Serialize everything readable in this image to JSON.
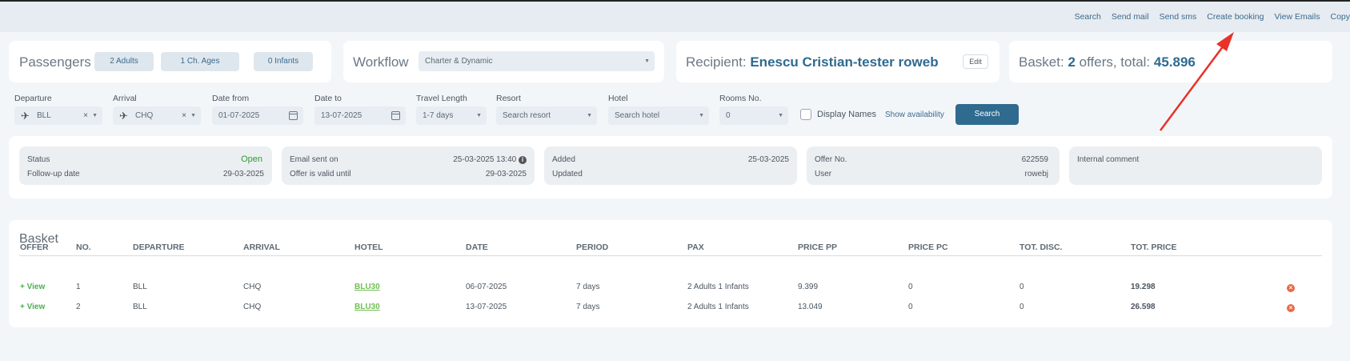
{
  "topnav": [
    "Search",
    "Send mail",
    "Send sms",
    "Create booking",
    "View Emails",
    "Copy"
  ],
  "passengers": {
    "title": "Passengers",
    "adults": "2 Adults",
    "children": "1 Ch. Ages",
    "infants": "0 Infants"
  },
  "workflow": {
    "title": "Workflow",
    "value": "Charter & Dynamic"
  },
  "recipient": {
    "label": "Recipient:",
    "name": "Enescu Cristian-tester roweb",
    "edit": "Edit"
  },
  "basket_summary": {
    "label": "Basket:",
    "count": "2",
    "mid": "offers, total:",
    "total": "45.896"
  },
  "search": {
    "departure_label": "Departure",
    "departure_value": "BLL",
    "arrival_label": "Arrival",
    "arrival_value": "CHQ",
    "date_from_label": "Date from",
    "date_from_value": "01-07-2025",
    "date_to_label": "Date to",
    "date_to_value": "13-07-2025",
    "travel_label": "Travel Length",
    "travel_value": "1-7 days",
    "resort_label": "Resort",
    "resort_placeholder": "Search resort",
    "hotel_label": "Hotel",
    "hotel_placeholder": "Search hotel",
    "rooms_label": "Rooms No.",
    "rooms_value": "0",
    "display_names": "Display Names",
    "show_availability": "Show availability",
    "search_button": "Search"
  },
  "status": {
    "status_label": "Status",
    "status_value": "Open",
    "followup_label": "Follow-up date",
    "followup_value": "29-03-2025"
  },
  "email": {
    "sent_label": "Email sent on",
    "sent_value": "25-03-2025 13:40",
    "valid_label": "Offer is valid until",
    "valid_value": "29-03-2025"
  },
  "added": {
    "added_label": "Added",
    "added_value": "25-03-2025",
    "updated_label": "Updated"
  },
  "offer": {
    "no_label": "Offer No.",
    "no_value": "622559",
    "user_label": "User",
    "user_value": "rowebj"
  },
  "comment": {
    "label": "Internal comment"
  },
  "colors": {
    "accent": "#2f6a8f",
    "open": "#2e9d2e",
    "link_green": "#4caf50",
    "delete": "#e86a4a"
  },
  "basket": {
    "title": "Basket",
    "columns": [
      "OFFER",
      "NO.",
      "DEPARTURE",
      "ARRIVAL",
      "HOTEL",
      "DATE",
      "PERIOD",
      "PAX",
      "PRICE PP",
      "PRICE PC",
      "TOT. DISC.",
      "TOT. PRICE"
    ],
    "rows": [
      {
        "offer": "+ View",
        "no": "1",
        "departure": "BLL",
        "arrival": "CHQ",
        "hotel": "BLU30",
        "date": "06-07-2025",
        "period": "7 days",
        "pax": "2 Adults 1 Infants",
        "price_pp": "9.399",
        "price_pc": "0",
        "disc": "0",
        "total": "19.298"
      },
      {
        "offer": "+ View",
        "no": "2",
        "departure": "BLL",
        "arrival": "CHQ",
        "hotel": "BLU30",
        "date": "13-07-2025",
        "period": "7 days",
        "pax": "2 Adults 1 Infants",
        "price_pp": "13.049",
        "price_pc": "0",
        "disc": "0",
        "total": "26.598"
      }
    ]
  }
}
